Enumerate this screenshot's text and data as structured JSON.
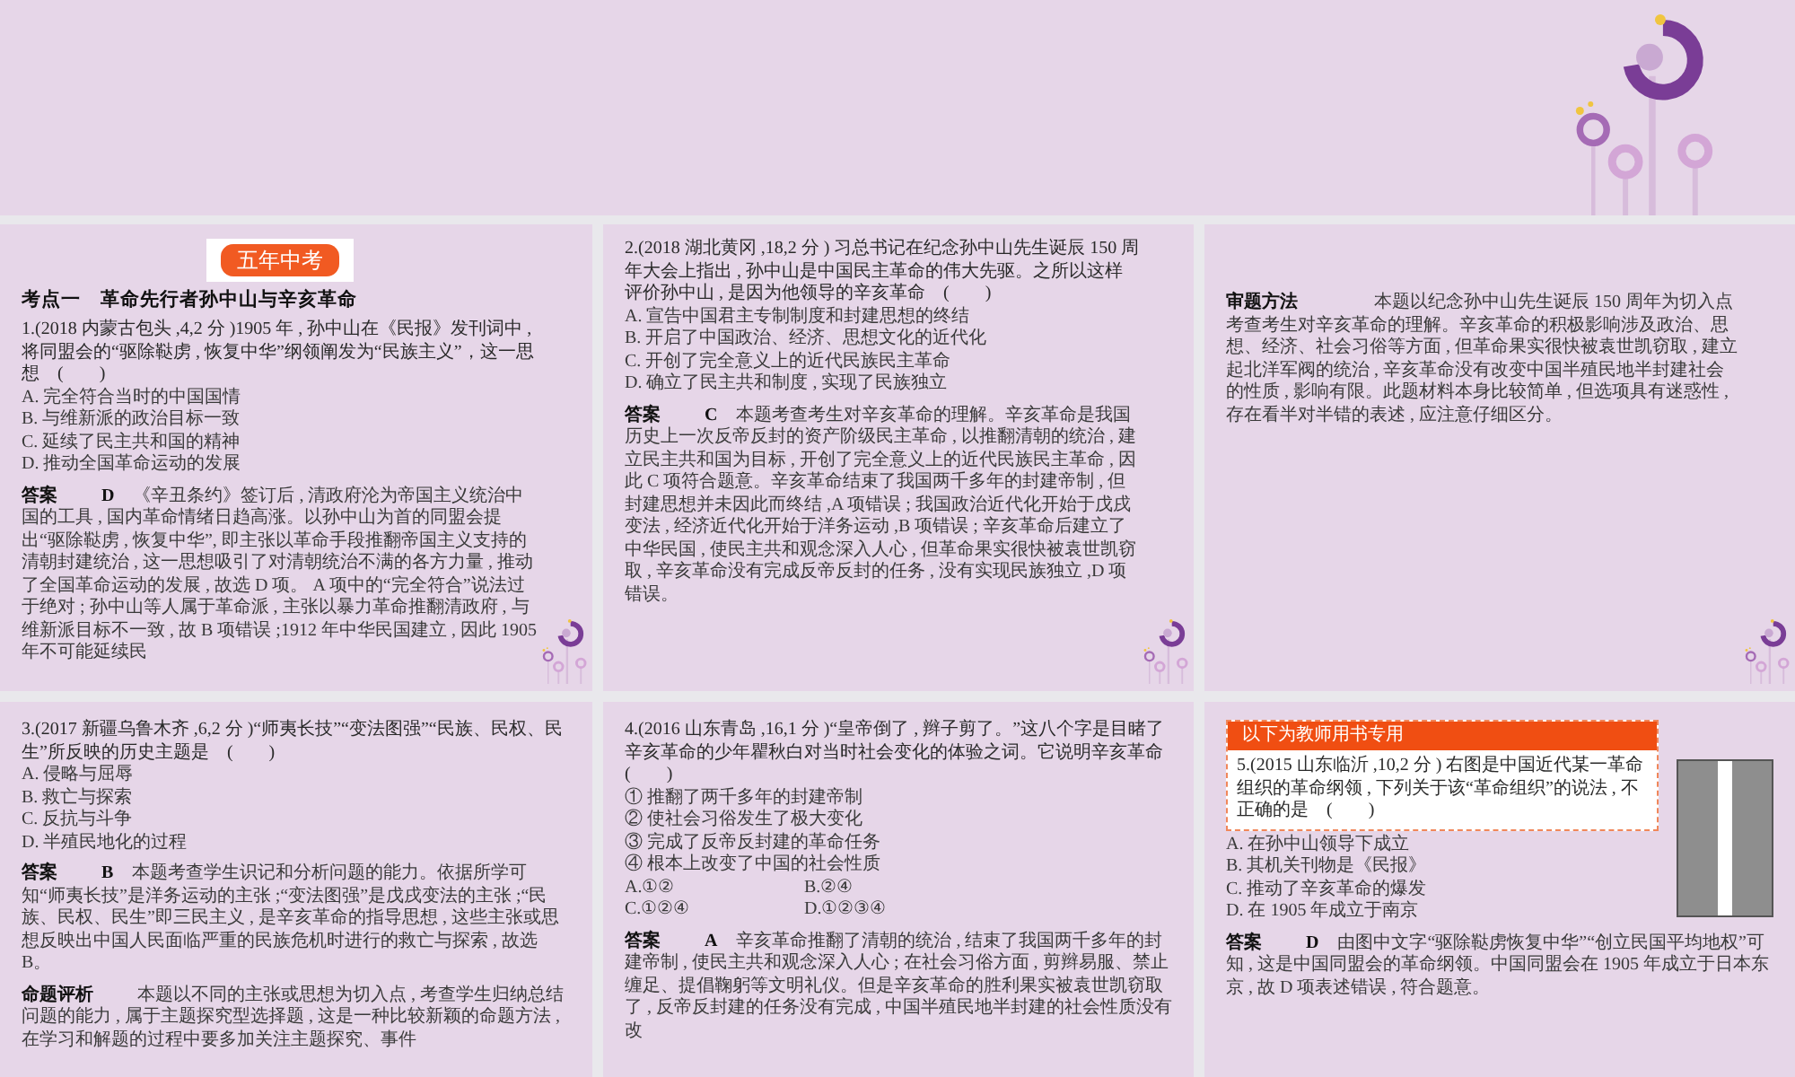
{
  "slides": [
    {
      "kind": "question",
      "badge": "五年中考",
      "heading": "考点一　革命先行者孙中山与辛亥革命",
      "question": "1.(2018 内蒙古包头 ,4,2 分 )1905 年 , 孙中山在《民报》发刊词中 , 将同盟会的“驱除鞑虏 , 恢复中华”纲领阐发为“民族主义”，这一思想    (        )",
      "options": [
        "A. 完全符合当时的中国国情",
        "B. 与维新派的政治目标一致",
        "C. 延续了民主共和国的精神",
        "D. 推动全国革命运动的发展"
      ],
      "answer": {
        "label": "答案",
        "choice": "D",
        "text": "《辛丑条约》签订后 , 清政府沦为帝国主义统治中国的工具 , 国内革命情绪日趋高涨。以孙中山为首的同盟会提出“驱除鞑虏 , 恢复中华”, 即主张以革命手段推翻帝国主义支持的清朝封建统治 , 这一思想吸引了对清朝统治不满的各方力量 , 推动了全国革命运动的发展 , 故选 D 项。 A 项中的“完全符合”说法过于绝对 ; 孙中山等人属于革命派 , 主张以暴力革命推翻清政府 , 与维新派目标不一致 , 故 B 项错误 ;1912 年中华民国建立 , 因此 1905 年不可能延续民"
      }
    },
    {
      "kind": "question",
      "question": "2.(2018 湖北黄冈 ,18,2 分 ) 习总书记在纪念孙中山先生诞辰 150 周年大会上指出 , 孙中山是中国民主革命的伟大先驱。之所以这样评价孙中山 , 是因为他领导的辛亥革命    (        )",
      "options": [
        "A. 宣告中国君主专制制度和封建思想的终结",
        "B. 开启了中国政治、经济、思想文化的近代化",
        "C. 开创了完全意义上的近代民族民主革命",
        "D. 确立了民主共和制度 , 实现了民族独立"
      ],
      "answer": {
        "label": "答案",
        "choice": "C",
        "text": "本题考查考生对辛亥革命的理解。辛亥革命是我国历史上一次反帝反封的资产阶级民主革命 , 以推翻清朝的统治 , 建立民主共和国为目标 , 开创了完全意义上的近代民族民主革命 , 因此 C 项符合题意。辛亥革命结束了我国两千多年的封建帝制 , 但封建思想并未因此而终结 ,A 项错误 ; 我国政治近代化开始于戊戌变法 , 经济近代化开始于洋务运动 ,B 项错误 ; 辛亥革命后建立了中华民国 , 使民主共和观念深入人心 , 但革命果实很快被袁世凯窃取 , 辛亥革命没有完成反帝反封的任务 , 没有实现民族独立 ,D 项错误。"
      }
    },
    {
      "kind": "analysis",
      "analysis": {
        "label": "审题方法",
        "text": "本题以纪念孙中山先生诞辰 150 周年为切入点考查考生对辛亥革命的理解。辛亥革命的积极影响涉及政治、思想、经济、社会习俗等方面 , 但革命果实很快被袁世凯窃取 , 建立起北洋军阀的统治 , 辛亥革命没有改变中国半殖民地半封建社会的性质 , 影响有限。此题材料本身比较简单 , 但选项具有迷惑性 , 存在看半对半错的表述 , 应注意仔细区分。"
      }
    },
    {
      "kind": "question",
      "question": "3.(2017 新疆乌鲁木齐 ,6,2 分 )“师夷长技”“变法图强”“民族、民权、民生”所反映的历史主题是    (        )",
      "options": [
        "A. 侵略与屈辱",
        "B. 救亡与探索",
        "C. 反抗与斗争",
        "D. 半殖民地化的过程"
      ],
      "answer": {
        "label": "答案",
        "choice": "B",
        "text": "本题考查学生识记和分析问题的能力。依据所学可知“师夷长技”是洋务运动的主张 ;“变法图强”是戊戌变法的主张 ;“民族、民权、民生”即三民主义 , 是辛亥革命的指导思想 , 这些主张或思想反映出中国人民面临严重的民族危机时进行的救亡与探索 , 故选 B。"
      },
      "review": {
        "label": "命题评析",
        "text": "本题以不同的主张或思想为切入点 , 考查学生归纳总结问题的能力 , 属于主题探究型选择题 , 这是一种比较新颖的命题方法 , 在学习和解题的过程中要多加关注主题探究、事件"
      }
    },
    {
      "kind": "question",
      "question": "4.(2016 山东青岛 ,16,1 分 )“皇帝倒了 , 辫子剪了。”这八个字是目睹了辛亥革命的少年瞿秋白对当时社会变化的体验之词。它说明辛亥革命    (        )",
      "statements": [
        "① 推翻了两千多年的封建帝制",
        "② 使社会习俗发生了极大变化",
        "③ 完成了反帝反封建的革命任务",
        "④ 根本上改变了中国的社会性质"
      ],
      "choices": [
        "A.①②",
        "B.②④",
        "C.①②④",
        "D.①②③④"
      ],
      "answer": {
        "label": "答案",
        "choice": "A",
        "text": "辛亥革命推翻了清朝的统治 , 结束了我国两千多年的封建帝制 , 使民主共和观念深入人心 ; 在社会习俗方面 , 剪辫易服、禁止缠足、提倡鞠躬等文明礼仪。但是辛亥革命的胜利果实被袁世凯窃取了 , 反帝反封建的任务没有完成 , 中国半殖民地半封建的社会性质没有改"
      }
    },
    {
      "kind": "question",
      "banner": "以下为教师用书专用",
      "has_figure": true,
      "question": "5.(2015 山东临沂 ,10,2 分 ) 右图是中国近代某一革命组织的革命纲领 , 下列关于该“革命组织”的说法 , 不正确的是    (        )",
      "options": [
        "A. 在孙中山领导下成立",
        "B. 其机关刊物是《民报》",
        "C. 推动了辛亥革命的爆发",
        "D. 在 1905 年成立于南京"
      ],
      "answer": {
        "label": "答案",
        "choice": "D",
        "text": "由图中文字“驱除鞑虏恢复中华”“创立民国平均地权”可知 , 这是中国同盟会的革命纲领。中国同盟会在 1905 年成立于日本东京 , 故 D 项表述错误 , 符合题意。"
      }
    }
  ]
}
